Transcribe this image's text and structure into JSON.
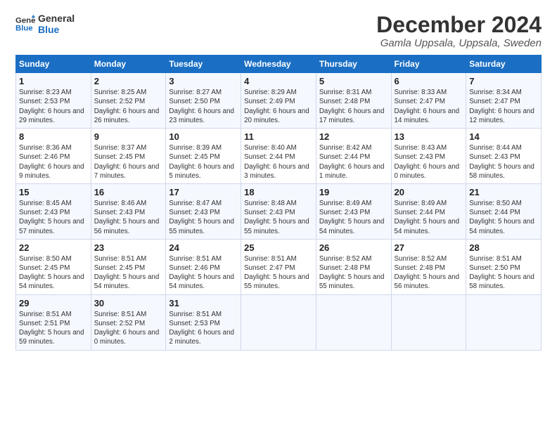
{
  "logo": {
    "text_general": "General",
    "text_blue": "Blue"
  },
  "title": "December 2024",
  "subtitle": "Gamla Uppsala, Uppsala, Sweden",
  "header": {
    "days": [
      "Sunday",
      "Monday",
      "Tuesday",
      "Wednesday",
      "Thursday",
      "Friday",
      "Saturday"
    ]
  },
  "weeks": [
    [
      {
        "day": "1",
        "sunrise": "8:23 AM",
        "sunset": "2:53 PM",
        "daylight": "6 hours and 29 minutes."
      },
      {
        "day": "2",
        "sunrise": "8:25 AM",
        "sunset": "2:52 PM",
        "daylight": "6 hours and 26 minutes."
      },
      {
        "day": "3",
        "sunrise": "8:27 AM",
        "sunset": "2:50 PM",
        "daylight": "6 hours and 23 minutes."
      },
      {
        "day": "4",
        "sunrise": "8:29 AM",
        "sunset": "2:49 PM",
        "daylight": "6 hours and 20 minutes."
      },
      {
        "day": "5",
        "sunrise": "8:31 AM",
        "sunset": "2:48 PM",
        "daylight": "6 hours and 17 minutes."
      },
      {
        "day": "6",
        "sunrise": "8:33 AM",
        "sunset": "2:47 PM",
        "daylight": "6 hours and 14 minutes."
      },
      {
        "day": "7",
        "sunrise": "8:34 AM",
        "sunset": "2:47 PM",
        "daylight": "6 hours and 12 minutes."
      }
    ],
    [
      {
        "day": "8",
        "sunrise": "8:36 AM",
        "sunset": "2:46 PM",
        "daylight": "6 hours and 9 minutes."
      },
      {
        "day": "9",
        "sunrise": "8:37 AM",
        "sunset": "2:45 PM",
        "daylight": "6 hours and 7 minutes."
      },
      {
        "day": "10",
        "sunrise": "8:39 AM",
        "sunset": "2:45 PM",
        "daylight": "6 hours and 5 minutes."
      },
      {
        "day": "11",
        "sunrise": "8:40 AM",
        "sunset": "2:44 PM",
        "daylight": "6 hours and 3 minutes."
      },
      {
        "day": "12",
        "sunrise": "8:42 AM",
        "sunset": "2:44 PM",
        "daylight": "6 hours and 1 minute."
      },
      {
        "day": "13",
        "sunrise": "8:43 AM",
        "sunset": "2:43 PM",
        "daylight": "6 hours and 0 minutes."
      },
      {
        "day": "14",
        "sunrise": "8:44 AM",
        "sunset": "2:43 PM",
        "daylight": "5 hours and 58 minutes."
      }
    ],
    [
      {
        "day": "15",
        "sunrise": "8:45 AM",
        "sunset": "2:43 PM",
        "daylight": "5 hours and 57 minutes."
      },
      {
        "day": "16",
        "sunrise": "8:46 AM",
        "sunset": "2:43 PM",
        "daylight": "5 hours and 56 minutes."
      },
      {
        "day": "17",
        "sunrise": "8:47 AM",
        "sunset": "2:43 PM",
        "daylight": "5 hours and 55 minutes."
      },
      {
        "day": "18",
        "sunrise": "8:48 AM",
        "sunset": "2:43 PM",
        "daylight": "5 hours and 55 minutes."
      },
      {
        "day": "19",
        "sunrise": "8:49 AM",
        "sunset": "2:43 PM",
        "daylight": "5 hours and 54 minutes."
      },
      {
        "day": "20",
        "sunrise": "8:49 AM",
        "sunset": "2:44 PM",
        "daylight": "5 hours and 54 minutes."
      },
      {
        "day": "21",
        "sunrise": "8:50 AM",
        "sunset": "2:44 PM",
        "daylight": "5 hours and 54 minutes."
      }
    ],
    [
      {
        "day": "22",
        "sunrise": "8:50 AM",
        "sunset": "2:45 PM",
        "daylight": "5 hours and 54 minutes."
      },
      {
        "day": "23",
        "sunrise": "8:51 AM",
        "sunset": "2:45 PM",
        "daylight": "5 hours and 54 minutes."
      },
      {
        "day": "24",
        "sunrise": "8:51 AM",
        "sunset": "2:46 PM",
        "daylight": "5 hours and 54 minutes."
      },
      {
        "day": "25",
        "sunrise": "8:51 AM",
        "sunset": "2:47 PM",
        "daylight": "5 hours and 55 minutes."
      },
      {
        "day": "26",
        "sunrise": "8:52 AM",
        "sunset": "2:48 PM",
        "daylight": "5 hours and 55 minutes."
      },
      {
        "day": "27",
        "sunrise": "8:52 AM",
        "sunset": "2:48 PM",
        "daylight": "5 hours and 56 minutes."
      },
      {
        "day": "28",
        "sunrise": "8:51 AM",
        "sunset": "2:50 PM",
        "daylight": "5 hours and 58 minutes."
      }
    ],
    [
      {
        "day": "29",
        "sunrise": "8:51 AM",
        "sunset": "2:51 PM",
        "daylight": "5 hours and 59 minutes."
      },
      {
        "day": "30",
        "sunrise": "8:51 AM",
        "sunset": "2:52 PM",
        "daylight": "6 hours and 0 minutes."
      },
      {
        "day": "31",
        "sunrise": "8:51 AM",
        "sunset": "2:53 PM",
        "daylight": "6 hours and 2 minutes."
      },
      null,
      null,
      null,
      null
    ]
  ]
}
